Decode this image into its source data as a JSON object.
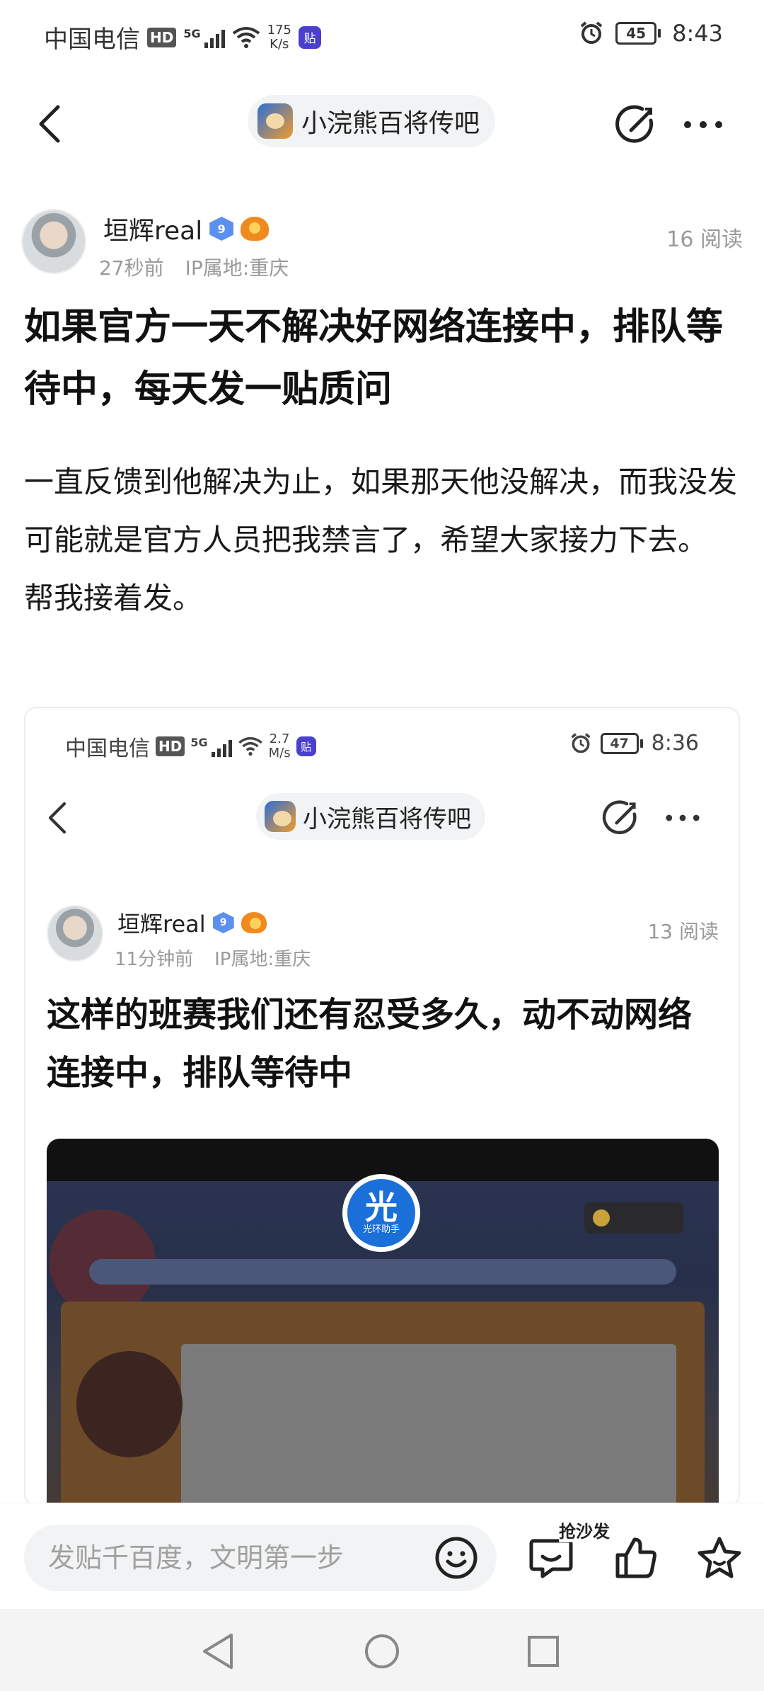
{
  "status_bar": {
    "carrier": "中国电信",
    "hd": "HD",
    "net_type": "5G",
    "net_speed_value": "175",
    "net_speed_unit": "K/s",
    "app_badge": "贴",
    "battery": "45",
    "time": "8:43"
  },
  "nav": {
    "forum_name": "小浣熊百将传吧"
  },
  "post": {
    "author": "垣辉real",
    "level": "9",
    "time_ago": "27秒前",
    "ip_location": "IP属地:重庆",
    "reads": "16 阅读",
    "title": "如果官方一天不解决好网络连接中，排队等待中，每天发一贴质问",
    "body": "一直反馈到他解决为止，如果那天他没解决，而我没发可能就是官方人员把我禁言了，希望大家接力下去。\n帮我接着发。"
  },
  "embedded": {
    "status_bar": {
      "carrier": "中国电信",
      "hd": "HD",
      "net_type": "5G",
      "net_speed_value": "2.7",
      "net_speed_unit": "M/s",
      "app_badge": "贴",
      "battery": "47",
      "time": "8:36"
    },
    "forum_name": "小浣熊百将传吧",
    "author": "垣辉real",
    "level": "9",
    "time_ago": "11分钟前",
    "ip_location": "IP属地:重庆",
    "reads": "13 阅读",
    "title": "这样的班赛我们还有忍受多久，动不动网络连接中，排队等待中",
    "image_logo_char": "光",
    "image_logo_text": "光环助手"
  },
  "bottom_bar": {
    "comment_placeholder": "发贴千百度，文明第一步",
    "sofa_label": "抢沙发"
  },
  "icons": {
    "back": "back-arrow-icon",
    "edit": "edit-icon",
    "more": "more-icon",
    "emoji": "emoji-icon",
    "comment": "comment-icon",
    "like": "thumbs-up-icon",
    "favorite": "star-icon"
  }
}
